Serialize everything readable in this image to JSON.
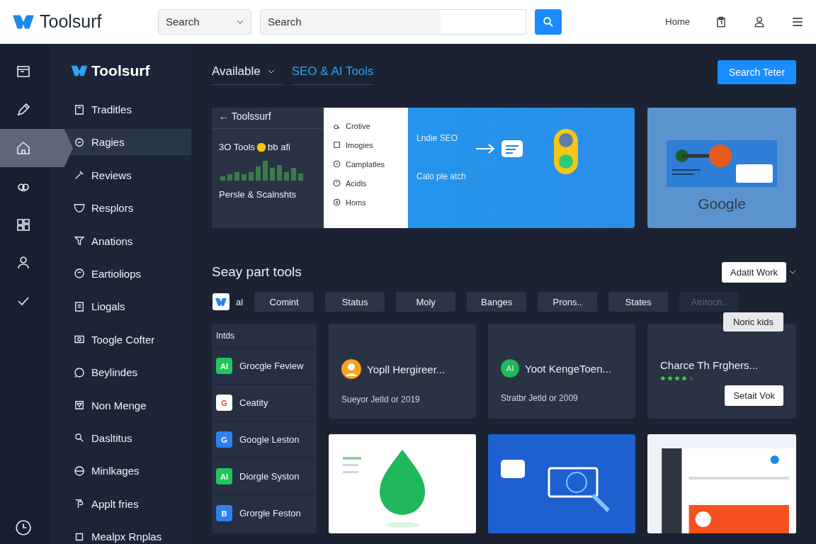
{
  "topbar": {
    "logo": "Toolsurf",
    "scope_select": "Search",
    "search": {
      "placeholder": "Search"
    },
    "nav_link": "Home"
  },
  "rail": [
    {
      "selected": false
    },
    {
      "selected": false
    },
    {
      "selected": true
    },
    {
      "selected": false
    },
    {
      "selected": false
    },
    {
      "selected": false
    },
    {
      "selected": false
    }
  ],
  "sidebar": {
    "logo": "Toolsurf",
    "items": [
      {
        "label": "Traditles",
        "selected": false
      },
      {
        "label": "Ragies",
        "selected": true
      },
      {
        "label": "Reviews",
        "selected": false
      },
      {
        "label": "Resplors",
        "selected": false
      },
      {
        "label": "Anations",
        "selected": false
      },
      {
        "label": "Eartioliops",
        "selected": false
      },
      {
        "label": "Liogals",
        "selected": false
      },
      {
        "label": "Toogle Cofter",
        "selected": false
      },
      {
        "label": "Beylindes",
        "selected": false
      },
      {
        "label": "Non Menge",
        "selected": false
      },
      {
        "label": "Dasltitus",
        "selected": false
      },
      {
        "label": "Minlkages",
        "selected": false
      },
      {
        "label": "Applt fries",
        "selected": false
      },
      {
        "label": "Mealpx Rnplas",
        "selected": false
      }
    ]
  },
  "header": {
    "dropdown": "Available",
    "link": "SEO & AI Tools",
    "button": "Search Teter"
  },
  "hero": {
    "back": "← Toolssurf",
    "headline": "3O Tools",
    "headline_end": "bb afi",
    "caption": "Persle & Scalnshts",
    "menu": [
      "Crotive",
      "Imogies",
      "Camplatles",
      "Acidls",
      "Homs"
    ],
    "promo_title": "Lndie SEO",
    "promo_caption": "Calo ple atch",
    "side_card": "Google"
  },
  "section": {
    "title": "Seay part tools",
    "action": "Adatit Work",
    "chip_label": "al",
    "chips": [
      {
        "label": "Comint",
        "disabled": false
      },
      {
        "label": "Status",
        "disabled": false
      },
      {
        "label": "Moly",
        "disabled": false
      },
      {
        "label": "Banges",
        "disabled": false
      },
      {
        "label": "Prons..",
        "disabled": false
      },
      {
        "label": "States",
        "disabled": false
      },
      {
        "label": "Atritoch..",
        "disabled": true
      }
    ],
    "tooltip": "Noric kids"
  },
  "list": {
    "heading": "Intds",
    "items": [
      {
        "badge": "AI",
        "label": "Grocgle Feview",
        "color": "#22c55e"
      },
      {
        "badge": "G",
        "label": "Ceatity",
        "color": "#ffffff"
      },
      {
        "badge": "G",
        "label": "Google Leston",
        "color": "#2f80ed"
      },
      {
        "badge": "AI",
        "label": "Diorgle Syston",
        "color": "#22c55e"
      },
      {
        "badge": "B",
        "label": "Grorgle Feston",
        "color": "#2f80ed"
      }
    ]
  },
  "cards": [
    {
      "kind": "person",
      "title": "Yopll Hergireer...",
      "subtitle": "Sueyor Jetld or 2019"
    },
    {
      "kind": "badge",
      "badge": "AI",
      "title": "Yoot KengeToen...",
      "subtitle": "Stratbr Jetld or 2009"
    },
    {
      "kind": "rated",
      "title": "Charce Th Frghers...",
      "stars": 4,
      "button": "Setait Vok"
    }
  ]
}
